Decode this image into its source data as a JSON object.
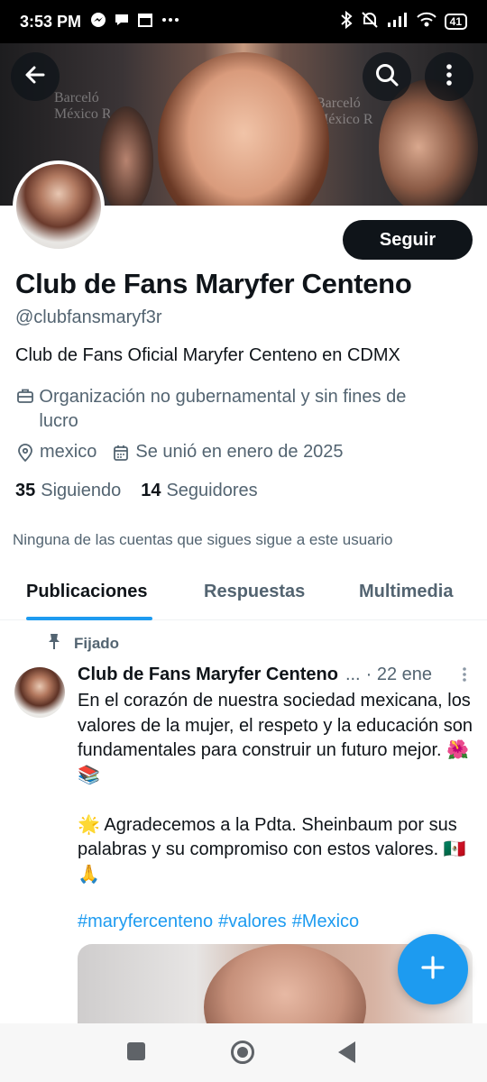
{
  "status_bar": {
    "time": "3:53 PM",
    "battery": "41",
    "left_icons": [
      "messenger-icon",
      "chat-bubble-icon",
      "calendar-icon",
      "more-horizontal-icon"
    ],
    "right_icons": [
      "bluetooth-icon",
      "mute-icon",
      "signal-icon",
      "wifi-icon",
      "battery-icon"
    ]
  },
  "header": {
    "back_icon": "arrow-left-icon",
    "search_icon": "search-icon",
    "more_icon": "more-vertical-icon",
    "banner_text_left": "Barceló\nMéxico R",
    "banner_text_right": "Barceló\nMéxico R"
  },
  "profile": {
    "follow_label": "Seguir",
    "name": "Club de Fans Maryfer Centeno",
    "handle": "@clubfansmaryf3r",
    "bio": "Club de Fans Oficial Maryfer Centeno en CDMX",
    "category": "Organización no gubernamental y sin fines de lucro",
    "location": "mexico",
    "joined": "Se unió en enero de 2025",
    "following_count": "35",
    "following_label": "Siguiendo",
    "followers_count": "14",
    "followers_label": "Seguidores",
    "mutuals_note": "Ninguna de las cuentas que sigues sigue a este usuario"
  },
  "tabs": [
    {
      "label": "Publicaciones",
      "active": true
    },
    {
      "label": "Respuestas",
      "active": false
    },
    {
      "label": "Multimedia",
      "active": false
    }
  ],
  "post": {
    "pinned_label": "Fijado",
    "author": "Club de Fans Maryfer Centeno",
    "truncation": "...",
    "date": "· 22 ene",
    "paragraph1": "En el corazón de nuestra sociedad mexicana, los valores de la mujer, el respeto y la educación son fundamentales para construir un futuro mejor. 🌺📚",
    "paragraph2": "🌟 Agradecemos a la Pdta. Sheinbaum por sus palabras y su compromiso con estos valores. 🇲🇽🙏",
    "hashtags": [
      "#maryfercenteno",
      "#valores",
      "#Mexico"
    ]
  },
  "fab": {
    "icon": "plus-icon"
  },
  "colors": {
    "accent": "#1d9bf0",
    "text": "#0f1419",
    "secondary": "#536471"
  }
}
